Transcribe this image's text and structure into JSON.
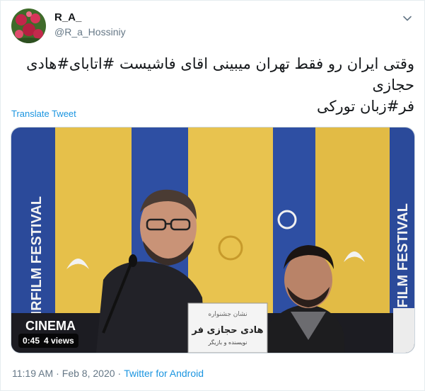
{
  "user": {
    "display_name": "R_A_",
    "handle": "@R_a_Hossiniy"
  },
  "tweet": {
    "text_line1": "وقتی ایران رو فقط تهران میبینی اقای فاشیست #اتابای#هادی حجازی",
    "text_line2": "فر#زبان تورکی",
    "translate_label": "Translate Tweet"
  },
  "video": {
    "duration": "0:45",
    "views": "4 views",
    "banner_text_left": "FAIRFILM FESTIVAL",
    "banner_text_right": "FAIRFILM FESTIVAL",
    "cinema_text": "CINEMA",
    "nameplate_text": "هادی حجازی فر",
    "nameplate_sub": "نویسنده و بازیگر"
  },
  "meta": {
    "time": "11:19 AM",
    "separator": "·",
    "date": "Feb 8, 2020",
    "source": "Twitter for Android"
  },
  "colors": {
    "link": "#1b95e0",
    "muted": "#657786",
    "banner_blue": "#2d4a9c",
    "banner_yellow": "#e8c24a"
  }
}
